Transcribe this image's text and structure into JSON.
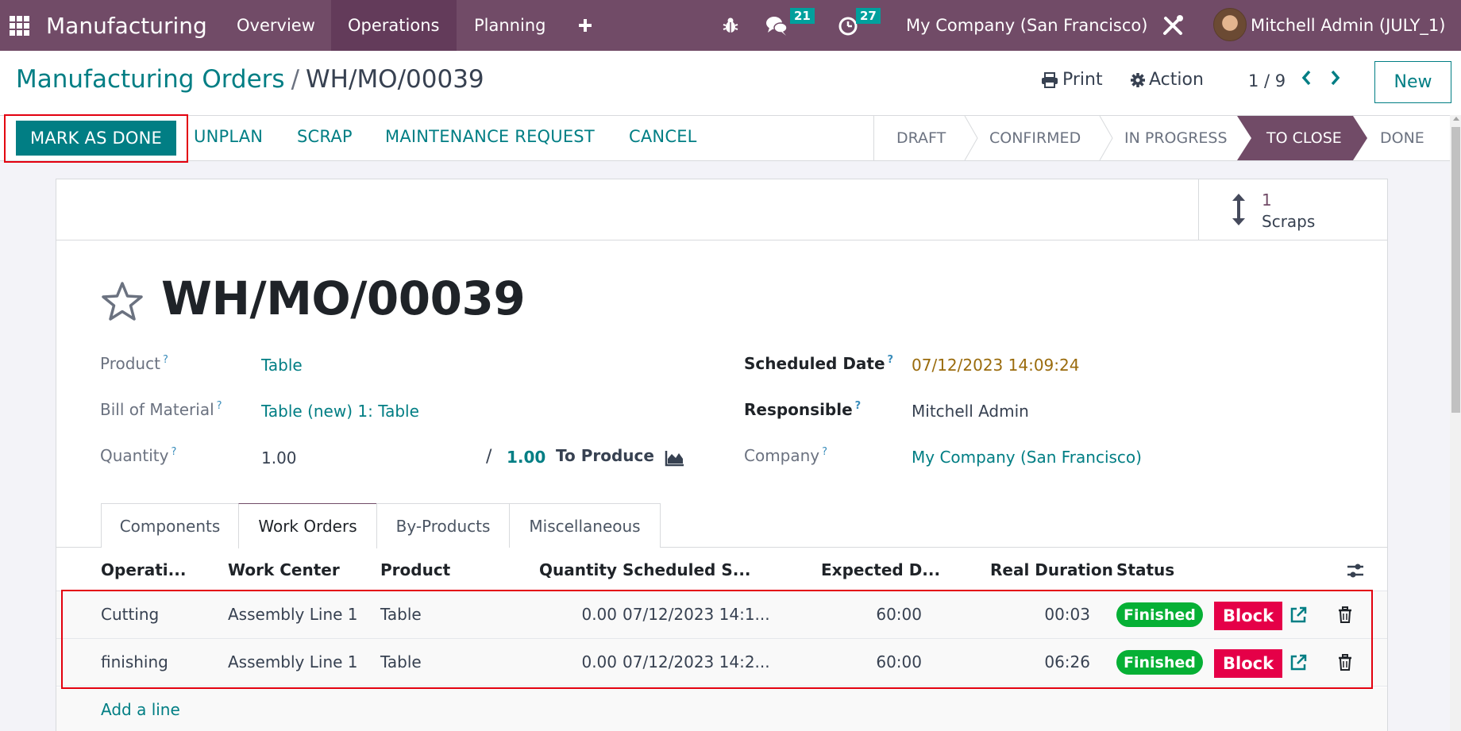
{
  "navbar": {
    "app_name": "Manufacturing",
    "menu": [
      {
        "label": "Overview",
        "active": false
      },
      {
        "label": "Operations",
        "active": true
      },
      {
        "label": "Planning",
        "active": false
      }
    ],
    "add_icon": "plus-icon",
    "debug_icon": "bug-icon",
    "messages_badge": "21",
    "activities_badge": "27",
    "company": "My Company (San Francisco)",
    "settings_icon": "tools-icon",
    "user": "Mitchell Admin (JULY_1)"
  },
  "breadcrumb": {
    "parent": "Manufacturing Orders",
    "separator": "/",
    "current": "WH/MO/00039"
  },
  "control": {
    "print_label": "Print",
    "action_label": "Action",
    "pager": "1 / 9",
    "new_label": "New"
  },
  "actions": {
    "primary": "MARK AS DONE",
    "buttons": [
      "UNPLAN",
      "SCRAP",
      "MAINTENANCE REQUEST",
      "CANCEL"
    ]
  },
  "statusbar": {
    "stages": [
      "DRAFT",
      "CONFIRMED",
      "IN PROGRESS",
      "TO CLOSE",
      "DONE"
    ],
    "current": "TO CLOSE"
  },
  "smart_buttons": {
    "scraps": {
      "value": "1",
      "label": "Scraps"
    }
  },
  "record": {
    "title": "WH/MO/00039",
    "favorite": false,
    "help_mark": "?",
    "fields_left": {
      "product": {
        "label": "Product",
        "value": "Table"
      },
      "bom": {
        "label": "Bill of Material",
        "value": "Table (new) 1: Table"
      },
      "quantity": {
        "label": "Quantity",
        "value": "1.00",
        "separator": "/",
        "target": "1.00",
        "suffix": "To Produce"
      }
    },
    "fields_right": {
      "scheduled_date": {
        "label": "Scheduled Date",
        "value": "07/12/2023 14:09:24"
      },
      "responsible": {
        "label": "Responsible",
        "value": "Mitchell Admin"
      },
      "company": {
        "label": "Company",
        "value": "My Company (San Francisco)"
      }
    }
  },
  "tabs": [
    {
      "label": "Components",
      "active": false
    },
    {
      "label": "Work Orders",
      "active": true
    },
    {
      "label": "By-Products",
      "active": false
    },
    {
      "label": "Miscellaneous",
      "active": false
    }
  ],
  "work_orders": {
    "columns": [
      "Operati...",
      "Work Center",
      "Product",
      "Quantity",
      "Scheduled S...",
      "Expected D...",
      "Real Duration",
      "Status"
    ],
    "rows": [
      {
        "operation": "Cutting",
        "work_center": "Assembly Line 1",
        "product": "Table",
        "quantity": "0.00",
        "scheduled": "07/12/2023 14:1...",
        "expected": "60:00",
        "real": "00:03",
        "status": "Finished",
        "block": "Block"
      },
      {
        "operation": "finishing",
        "work_center": "Assembly Line 1",
        "product": "Table",
        "quantity": "0.00",
        "scheduled": "07/12/2023 14:2...",
        "expected": "60:00",
        "real": "06:26",
        "status": "Finished",
        "block": "Block"
      }
    ],
    "add_line": "Add a line"
  },
  "colors": {
    "brand": "#714b67",
    "primary": "#017e84",
    "status_finished": "#06b035",
    "block": "#e50048",
    "highlight": "#e3000f"
  }
}
